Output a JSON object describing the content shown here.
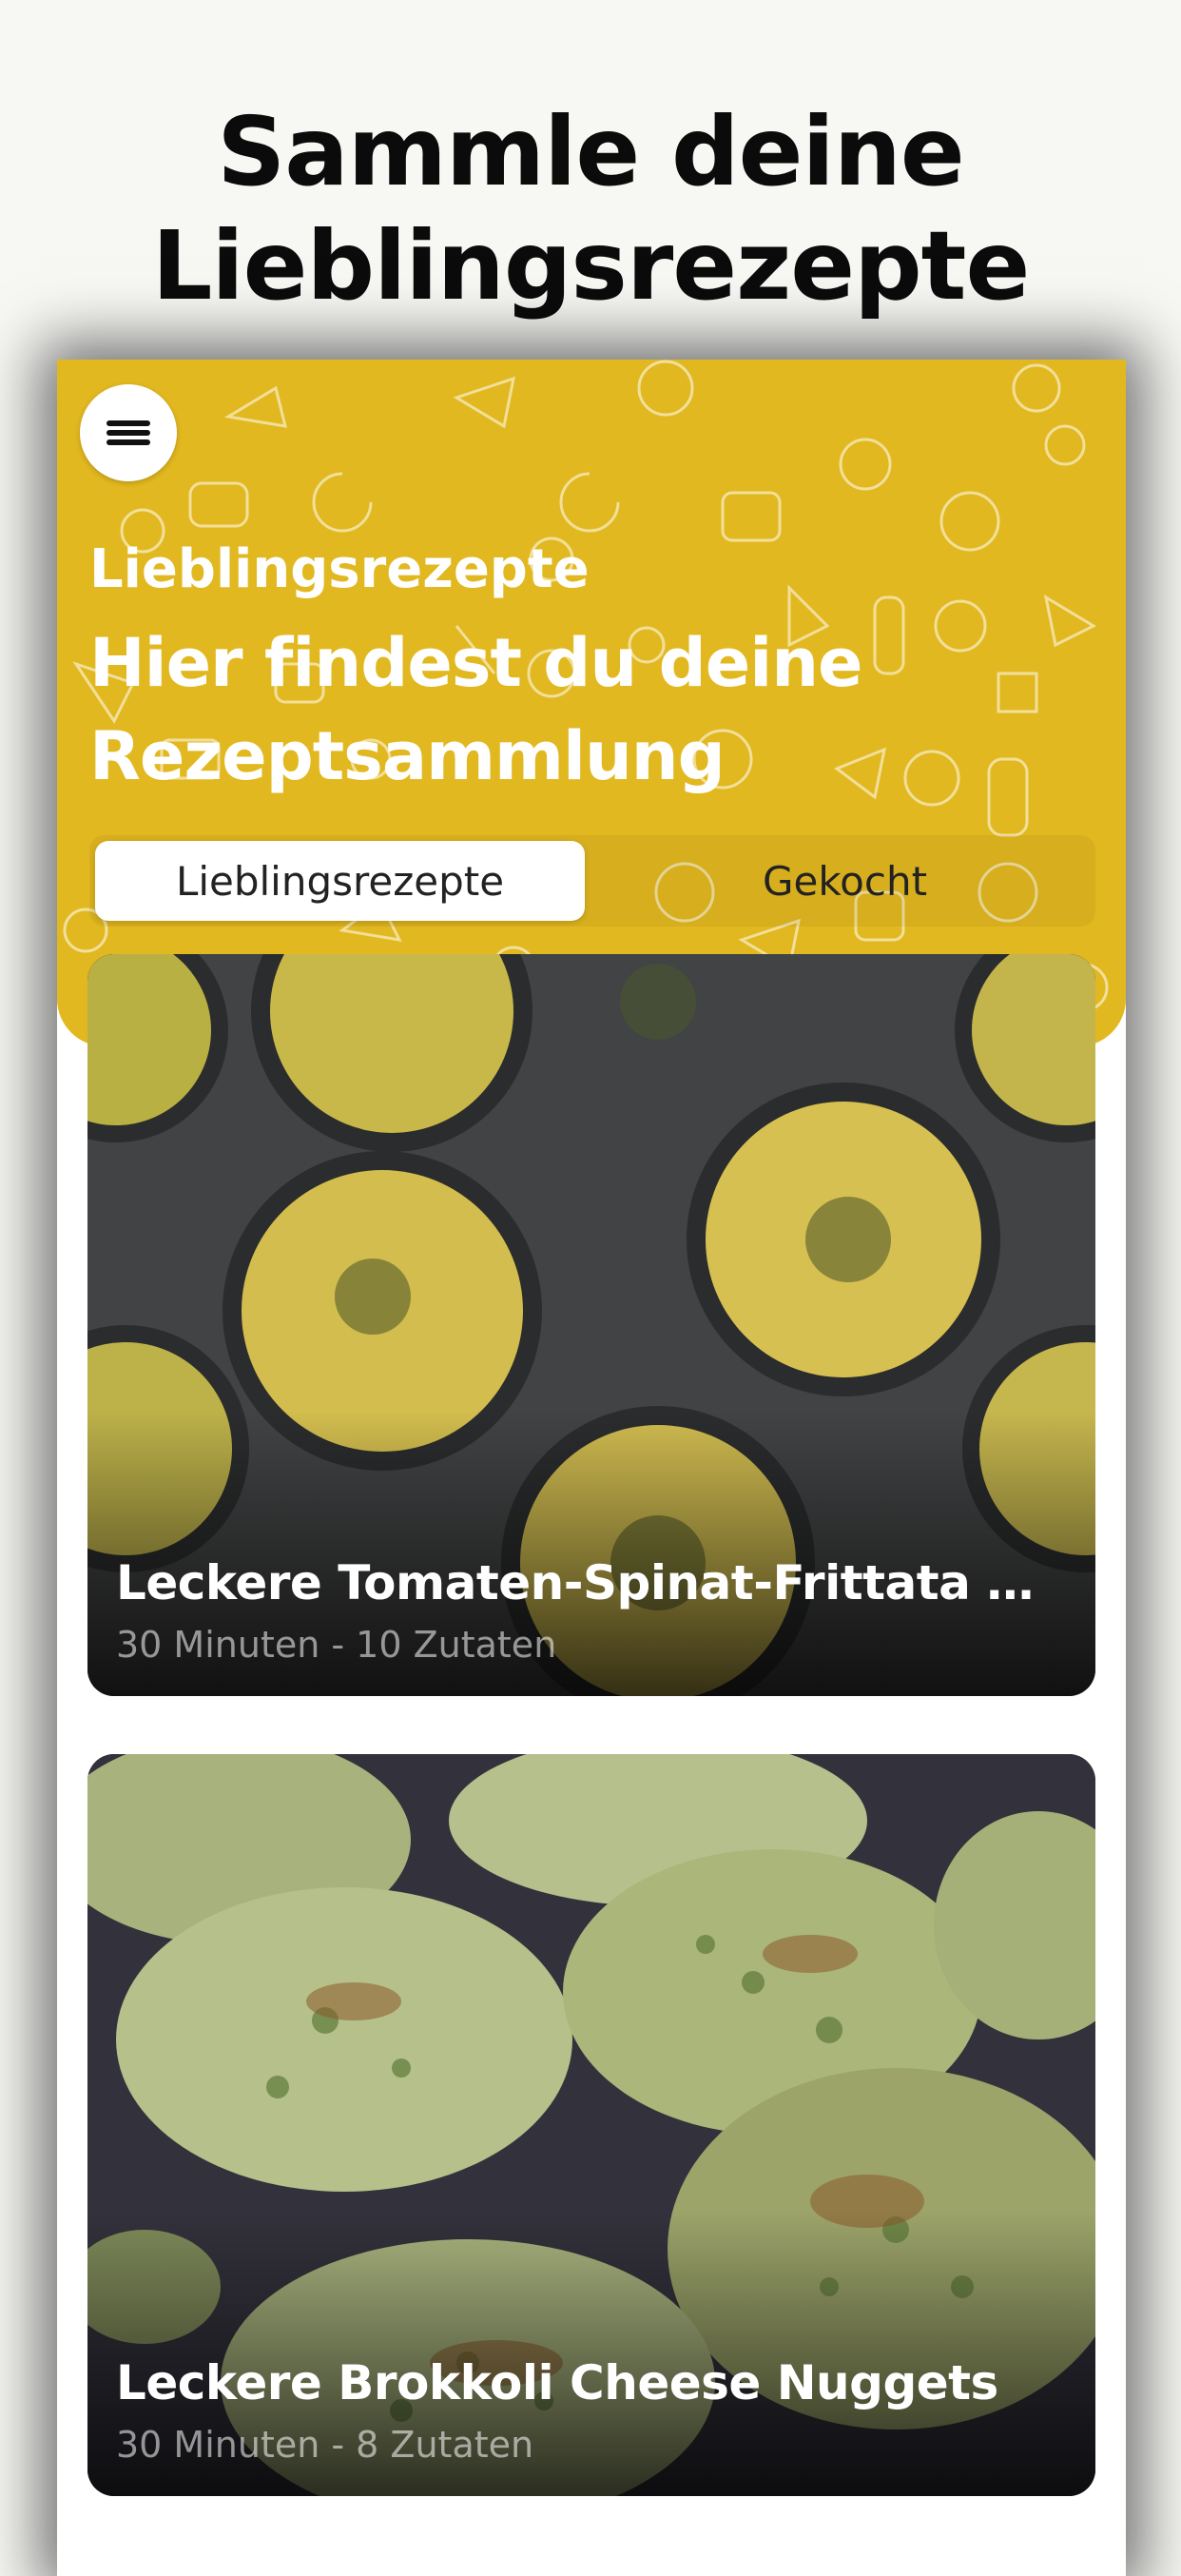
{
  "promo": {
    "title_line1": "Sammle deine",
    "title_line2": "Lieblingsrezepte"
  },
  "header": {
    "subtitle": "Lieblingsrezepte",
    "heading_line1": "Hier findest du deine",
    "heading_line2": "Rezeptsammlung",
    "background_color": "#e2b820"
  },
  "tabs": [
    {
      "label": "Lieblingsrezepte",
      "selected": true
    },
    {
      "label": "Gekocht",
      "selected": false
    }
  ],
  "recipes": [
    {
      "title": "Leckere Tomaten-Spinat-Frittata mit...",
      "meta": "30 Minuten - 10 Zutaten",
      "image": "frittata-muffins"
    },
    {
      "title": "Leckere Brokkoli Cheese Nuggets",
      "meta": "30 Minuten - 8 Zutaten",
      "image": "broccoli-nuggets"
    }
  ],
  "icons": {
    "menu": "hamburger-menu-icon"
  }
}
